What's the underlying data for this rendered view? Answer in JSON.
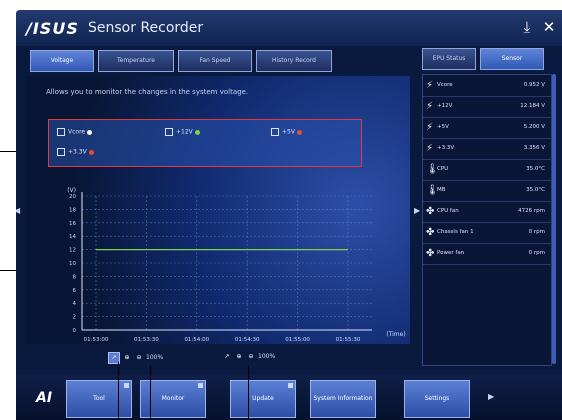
{
  "window": {
    "logo": "/ISUS",
    "title": "Sensor Recorder",
    "download_icon": "download-icon",
    "close_icon": "close-icon"
  },
  "tabs": [
    {
      "label": "Voltage",
      "active": true
    },
    {
      "label": "Temperature",
      "active": false
    },
    {
      "label": "Fan Speed",
      "active": false
    },
    {
      "label": "History Record",
      "active": false
    }
  ],
  "main": {
    "info_text": "Allows you to monitor the changes in the system voltage.",
    "checkboxes": [
      {
        "label": "Vcore",
        "checked": true,
        "color": "#ffffff"
      },
      {
        "label": "+12V",
        "checked": true,
        "color": "#7fd14a"
      },
      {
        "label": "+5V",
        "checked": true,
        "color": "#e84a3a"
      },
      {
        "label": "+3.3V",
        "checked": true,
        "color": "#e84a3a"
      }
    ]
  },
  "chart_data": {
    "type": "line",
    "ylabel": "(V)",
    "xlabel": "(Time)",
    "y_ticks": [
      "20",
      "18",
      "16",
      "14",
      "12",
      "10",
      "8",
      "6",
      "4",
      "2",
      "0"
    ],
    "x_ticks": [
      "01:53:00",
      "01:53:30",
      "01:54:00",
      "01:54:30",
      "01:55:00",
      "01:55:30"
    ],
    "ylim": [
      0,
      20
    ],
    "grid": true,
    "series": [
      {
        "name": "+12V",
        "color": "#7fd14a",
        "values": [
          12,
          12,
          12,
          12,
          12,
          12
        ]
      }
    ]
  },
  "zoom_controls": [
    {
      "select_icon": "select-icon",
      "zoom_in_icon": "zoom-in-icon",
      "zoom_out_icon": "zoom-out-icon",
      "level": "100%"
    },
    {
      "select_icon": "select-icon",
      "zoom_in_icon": "zoom-in-icon",
      "zoom_out_icon": "zoom-out-icon",
      "level": "100%"
    }
  ],
  "right_panel": {
    "tabs": [
      {
        "label": "EPU Status",
        "active": false
      },
      {
        "label": "Sensor",
        "active": true
      }
    ],
    "rows": [
      {
        "icon": "voltage-icon",
        "label": "Vcore",
        "value": "0.952 V"
      },
      {
        "icon": "voltage-icon",
        "label": "+12V",
        "value": "12.184 V"
      },
      {
        "icon": "voltage-icon",
        "label": "+5V",
        "value": "5.200 V"
      },
      {
        "icon": "voltage-icon",
        "label": "+3.3V",
        "value": "3.356 V"
      },
      {
        "icon": "thermometer-icon",
        "label": "CPU",
        "value": "35.0°C"
      },
      {
        "icon": "thermometer-icon",
        "label": "MB",
        "value": "35.0°C"
      },
      {
        "icon": "fan-icon",
        "label": "CPU fan",
        "value": "4726 rpm"
      },
      {
        "icon": "fan-icon",
        "label": "Chassis fan 1",
        "value": "0 rpm"
      },
      {
        "icon": "fan-icon",
        "label": "Power fan",
        "value": "0 rpm"
      }
    ]
  },
  "bottom_bar": {
    "logo": "AI",
    "buttons": [
      {
        "label": "Tool",
        "active": true
      },
      {
        "label": "Monitor",
        "active": true
      },
      {
        "label": "Update",
        "active": false
      },
      {
        "label": "System Information",
        "active": false
      },
      {
        "label": "Settings",
        "active": false
      }
    ]
  }
}
